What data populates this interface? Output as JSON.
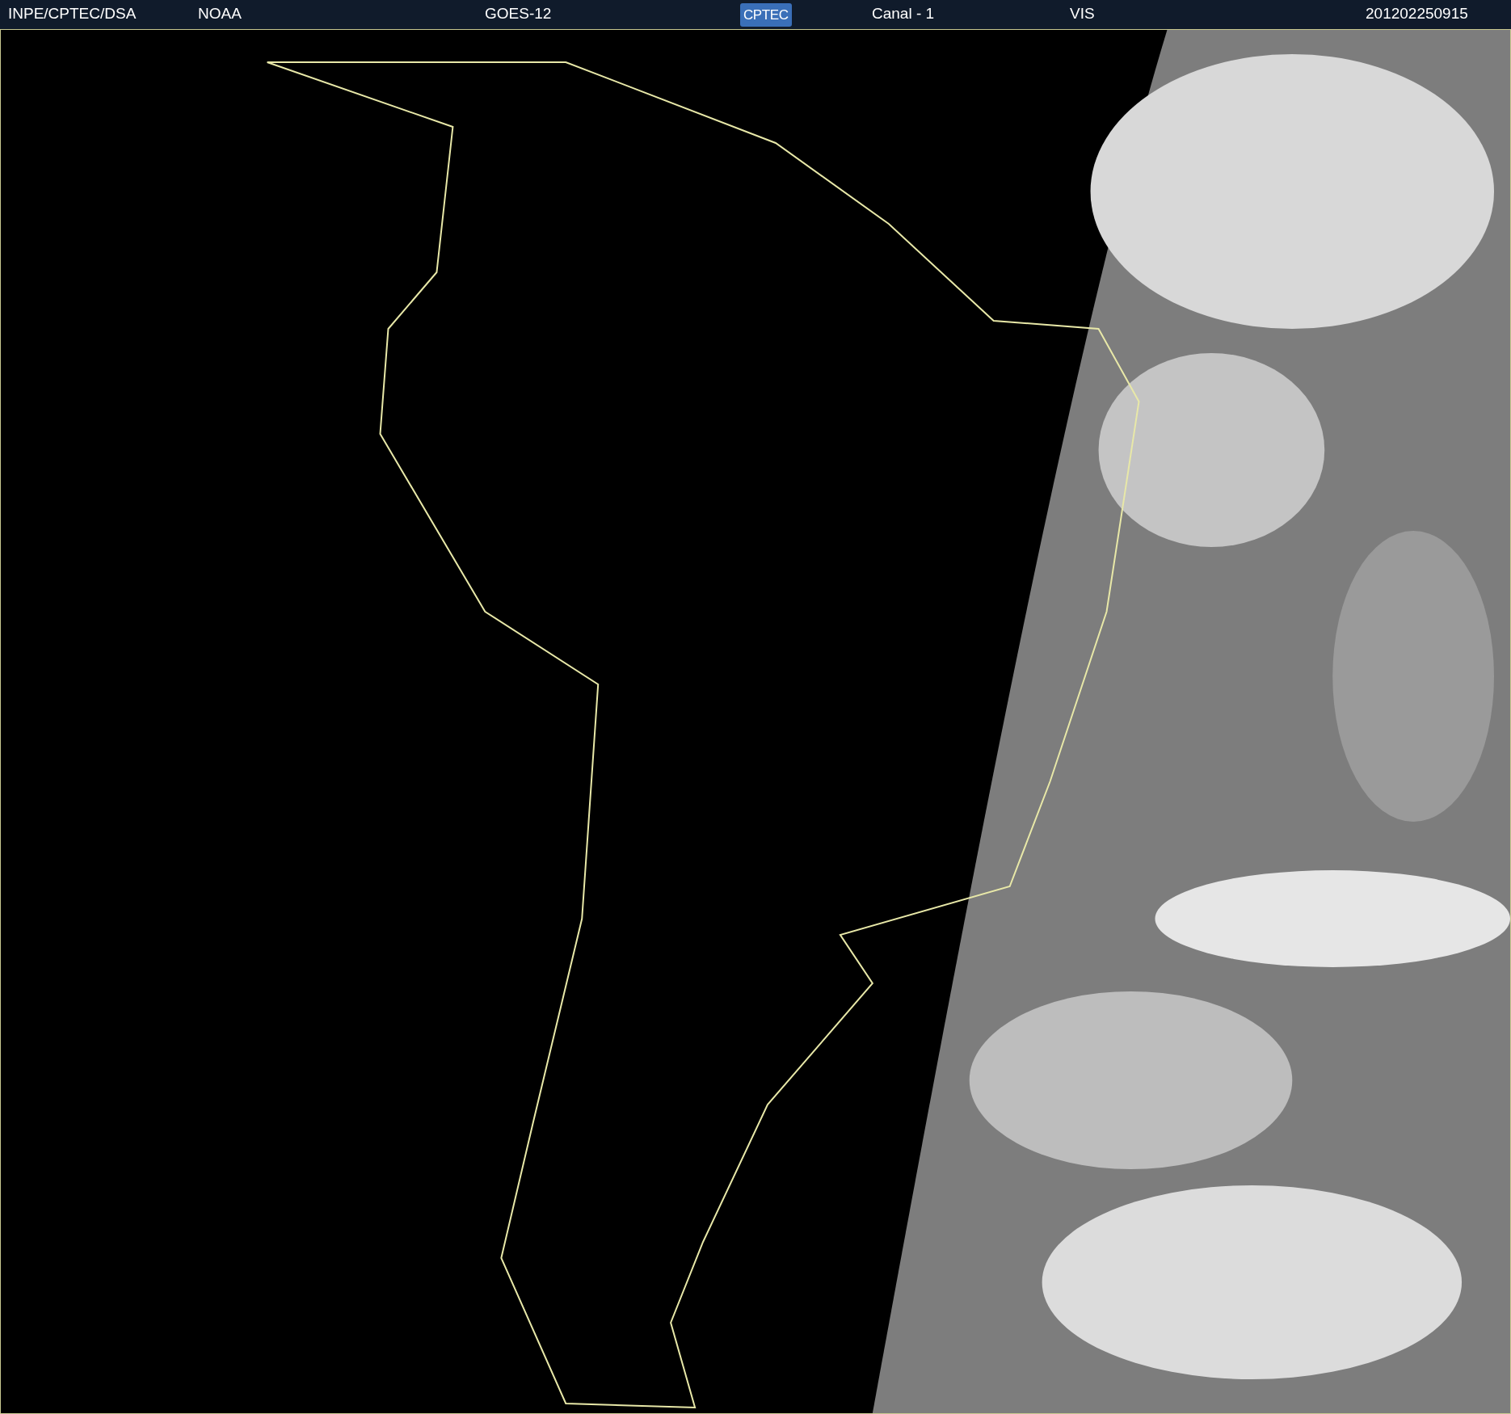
{
  "header": {
    "source": "INPE/CPTEC/DSA",
    "agency": "NOAA",
    "satellite": "GOES-12",
    "logo": "CPTEC",
    "channel": "Canal - 1",
    "band": "VIS",
    "timestamp": "201202250915"
  }
}
